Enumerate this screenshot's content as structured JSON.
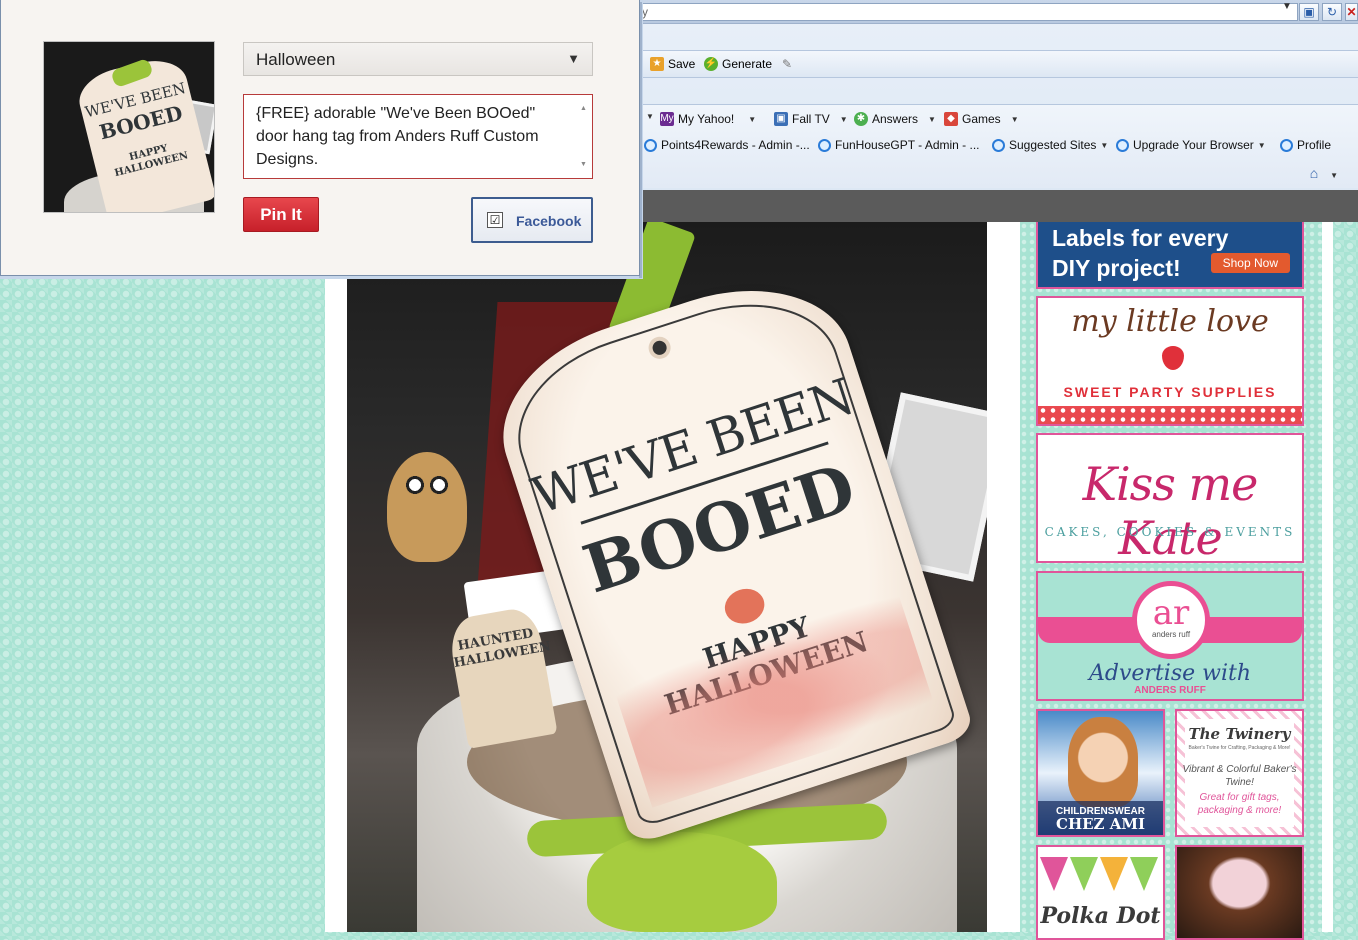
{
  "pin_dialog": {
    "board_selected": "Halloween",
    "description": "{FREE}  adorable \"We've Been BOOed\" door hang tag from Anders Ruff Custom Designs.",
    "pin_button": "Pin It",
    "facebook_label": "Facebook",
    "facebook_checked": "☑",
    "thumbnail_text": {
      "line1": "WE'VE BEEN",
      "line2": "BOOED",
      "line3": "HAPPY",
      "line4": "HALLOWEEN"
    }
  },
  "browser": {
    "address_partial": "y",
    "command_bar": {
      "save": "Save",
      "generate": "Generate"
    },
    "yahoo_bar": [
      {
        "label": "My Yahoo!",
        "icon": "yahoo-icon"
      },
      {
        "label": "Fall TV",
        "icon": "tv-icon"
      },
      {
        "label": "Answers",
        "icon": "answers-icon"
      },
      {
        "label": "Games",
        "icon": "games-icon"
      }
    ],
    "favorites_bar": [
      {
        "label": "Points4Rewards - Admin -..."
      },
      {
        "label": "FunHouseGPT - Admin - ..."
      },
      {
        "label": "Suggested Sites"
      },
      {
        "label": "Upgrade Your Browser"
      },
      {
        "label": "Profile"
      }
    ]
  },
  "main_photo": {
    "tag_line1": "WE'VE BEEN",
    "tag_line2": "BOOED",
    "tag_line3": "HAPPY",
    "tag_line4": "HALLOWEEN",
    "small_tag": "HAUNTED HALLOWEEN"
  },
  "sidebar_ads": {
    "labels_ad": {
      "line1": "Labels for every",
      "line2": "DIY project!",
      "button": "Shop Now"
    },
    "love_ad": {
      "script": "my little love",
      "sub": "SWEET PARTY SUPPLIES"
    },
    "kate_ad": {
      "script": "Kiss me Kate",
      "sub": "CAKES, COOKIES & EVENTS"
    },
    "anders_ad": {
      "logo": "ar",
      "logo_sub": "anders ruff",
      "adv": "Advertise with",
      "by": "ANDERS RUFF"
    },
    "chez_ad": {
      "line1": "CHILDRENSWEAR",
      "line2": "CHEZ AMI"
    },
    "twinery_ad": {
      "title": "The Twinery",
      "tagline": "Baker's Twine for Crafting, Packaging & More!",
      "body": "Vibrant & Colorful Baker's Twine!",
      "promo": "Great for gift tags, packaging & more!"
    },
    "polka_ad": {
      "title": "Polka Dot"
    }
  },
  "colors": {
    "page_bg": "#a8e3d3",
    "pin_red": "#cb2027",
    "facebook_blue": "#3b5998",
    "ad_border": "#e0559a"
  }
}
